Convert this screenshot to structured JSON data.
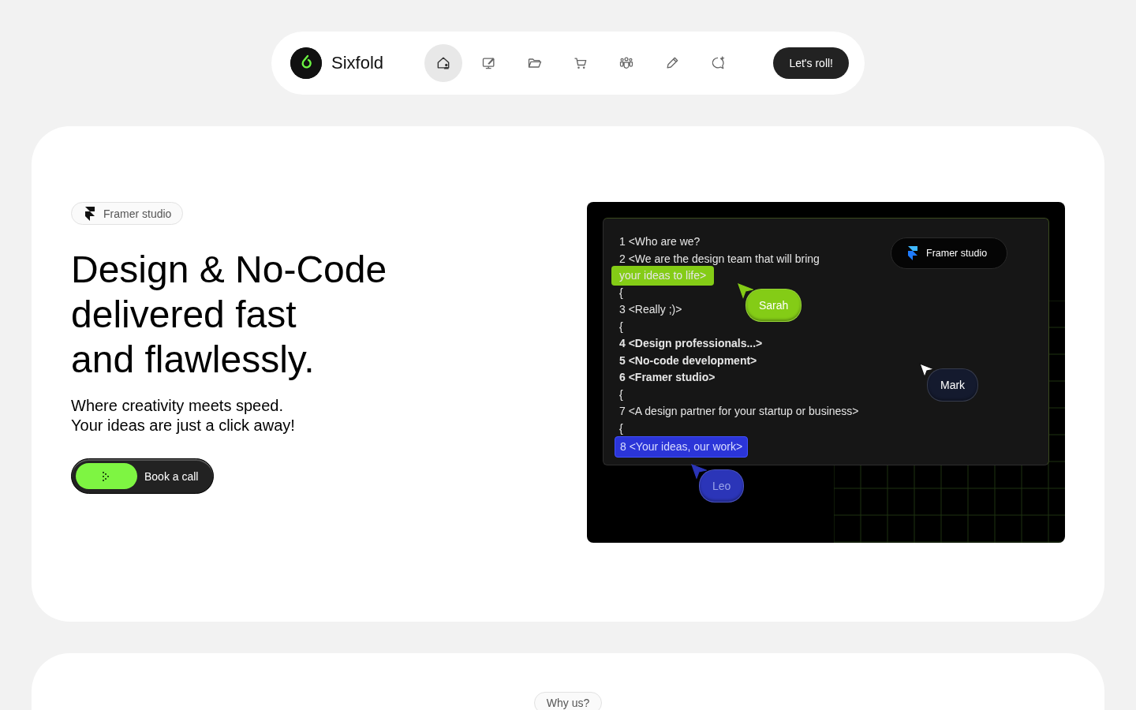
{
  "nav": {
    "brand": "Sixfold",
    "items": [
      {
        "kind": "home",
        "selected": true
      },
      {
        "kind": "monitor",
        "selected": false
      },
      {
        "kind": "folder",
        "selected": false
      },
      {
        "kind": "cart",
        "selected": false
      },
      {
        "kind": "people",
        "selected": false
      },
      {
        "kind": "pencil",
        "selected": false
      },
      {
        "kind": "chat",
        "selected": false
      }
    ],
    "cta": "Let's roll!"
  },
  "hero": {
    "badge": "Framer studio",
    "heading": [
      "Design & No-Code",
      "delivered fast",
      "and flawlessly."
    ],
    "subtitle": [
      "Where creativity meets speed.",
      "Your ideas are just a click away!"
    ],
    "button": "Book a call"
  },
  "demo": {
    "badge": "Framer studio",
    "lines": [
      {
        "text": "1 <Who are we?",
        "kind": "plain"
      },
      {
        "text": "2 <We are the design team that will bring",
        "kind": "plain"
      },
      {
        "text": "your ideas to life>",
        "kind": "green"
      },
      {
        "text": "{",
        "kind": "plain"
      },
      {
        "text": "3 <Really ;)>",
        "kind": "plain"
      },
      {
        "text": "{",
        "kind": "plain"
      },
      {
        "text": "4 <Design professionals...>",
        "kind": "bold"
      },
      {
        "text": "5 <No-code development>",
        "kind": "bold"
      },
      {
        "text": "6 <Framer studio>",
        "kind": "bold"
      },
      {
        "text": "{",
        "kind": "plain"
      },
      {
        "text": "7 <A design partner for your startup or business>",
        "kind": "plain"
      },
      {
        "text": "{",
        "kind": "plain"
      },
      {
        "text": "8 <Your ideas, our work>",
        "kind": "blue"
      }
    ],
    "cursors": [
      {
        "name": "Sarah",
        "color": "#84cc16"
      },
      {
        "name": "Mark",
        "color": "#141a2e"
      },
      {
        "name": "Leo",
        "color": "#2b35b8"
      }
    ]
  },
  "next": {
    "badge": "Why us?"
  }
}
